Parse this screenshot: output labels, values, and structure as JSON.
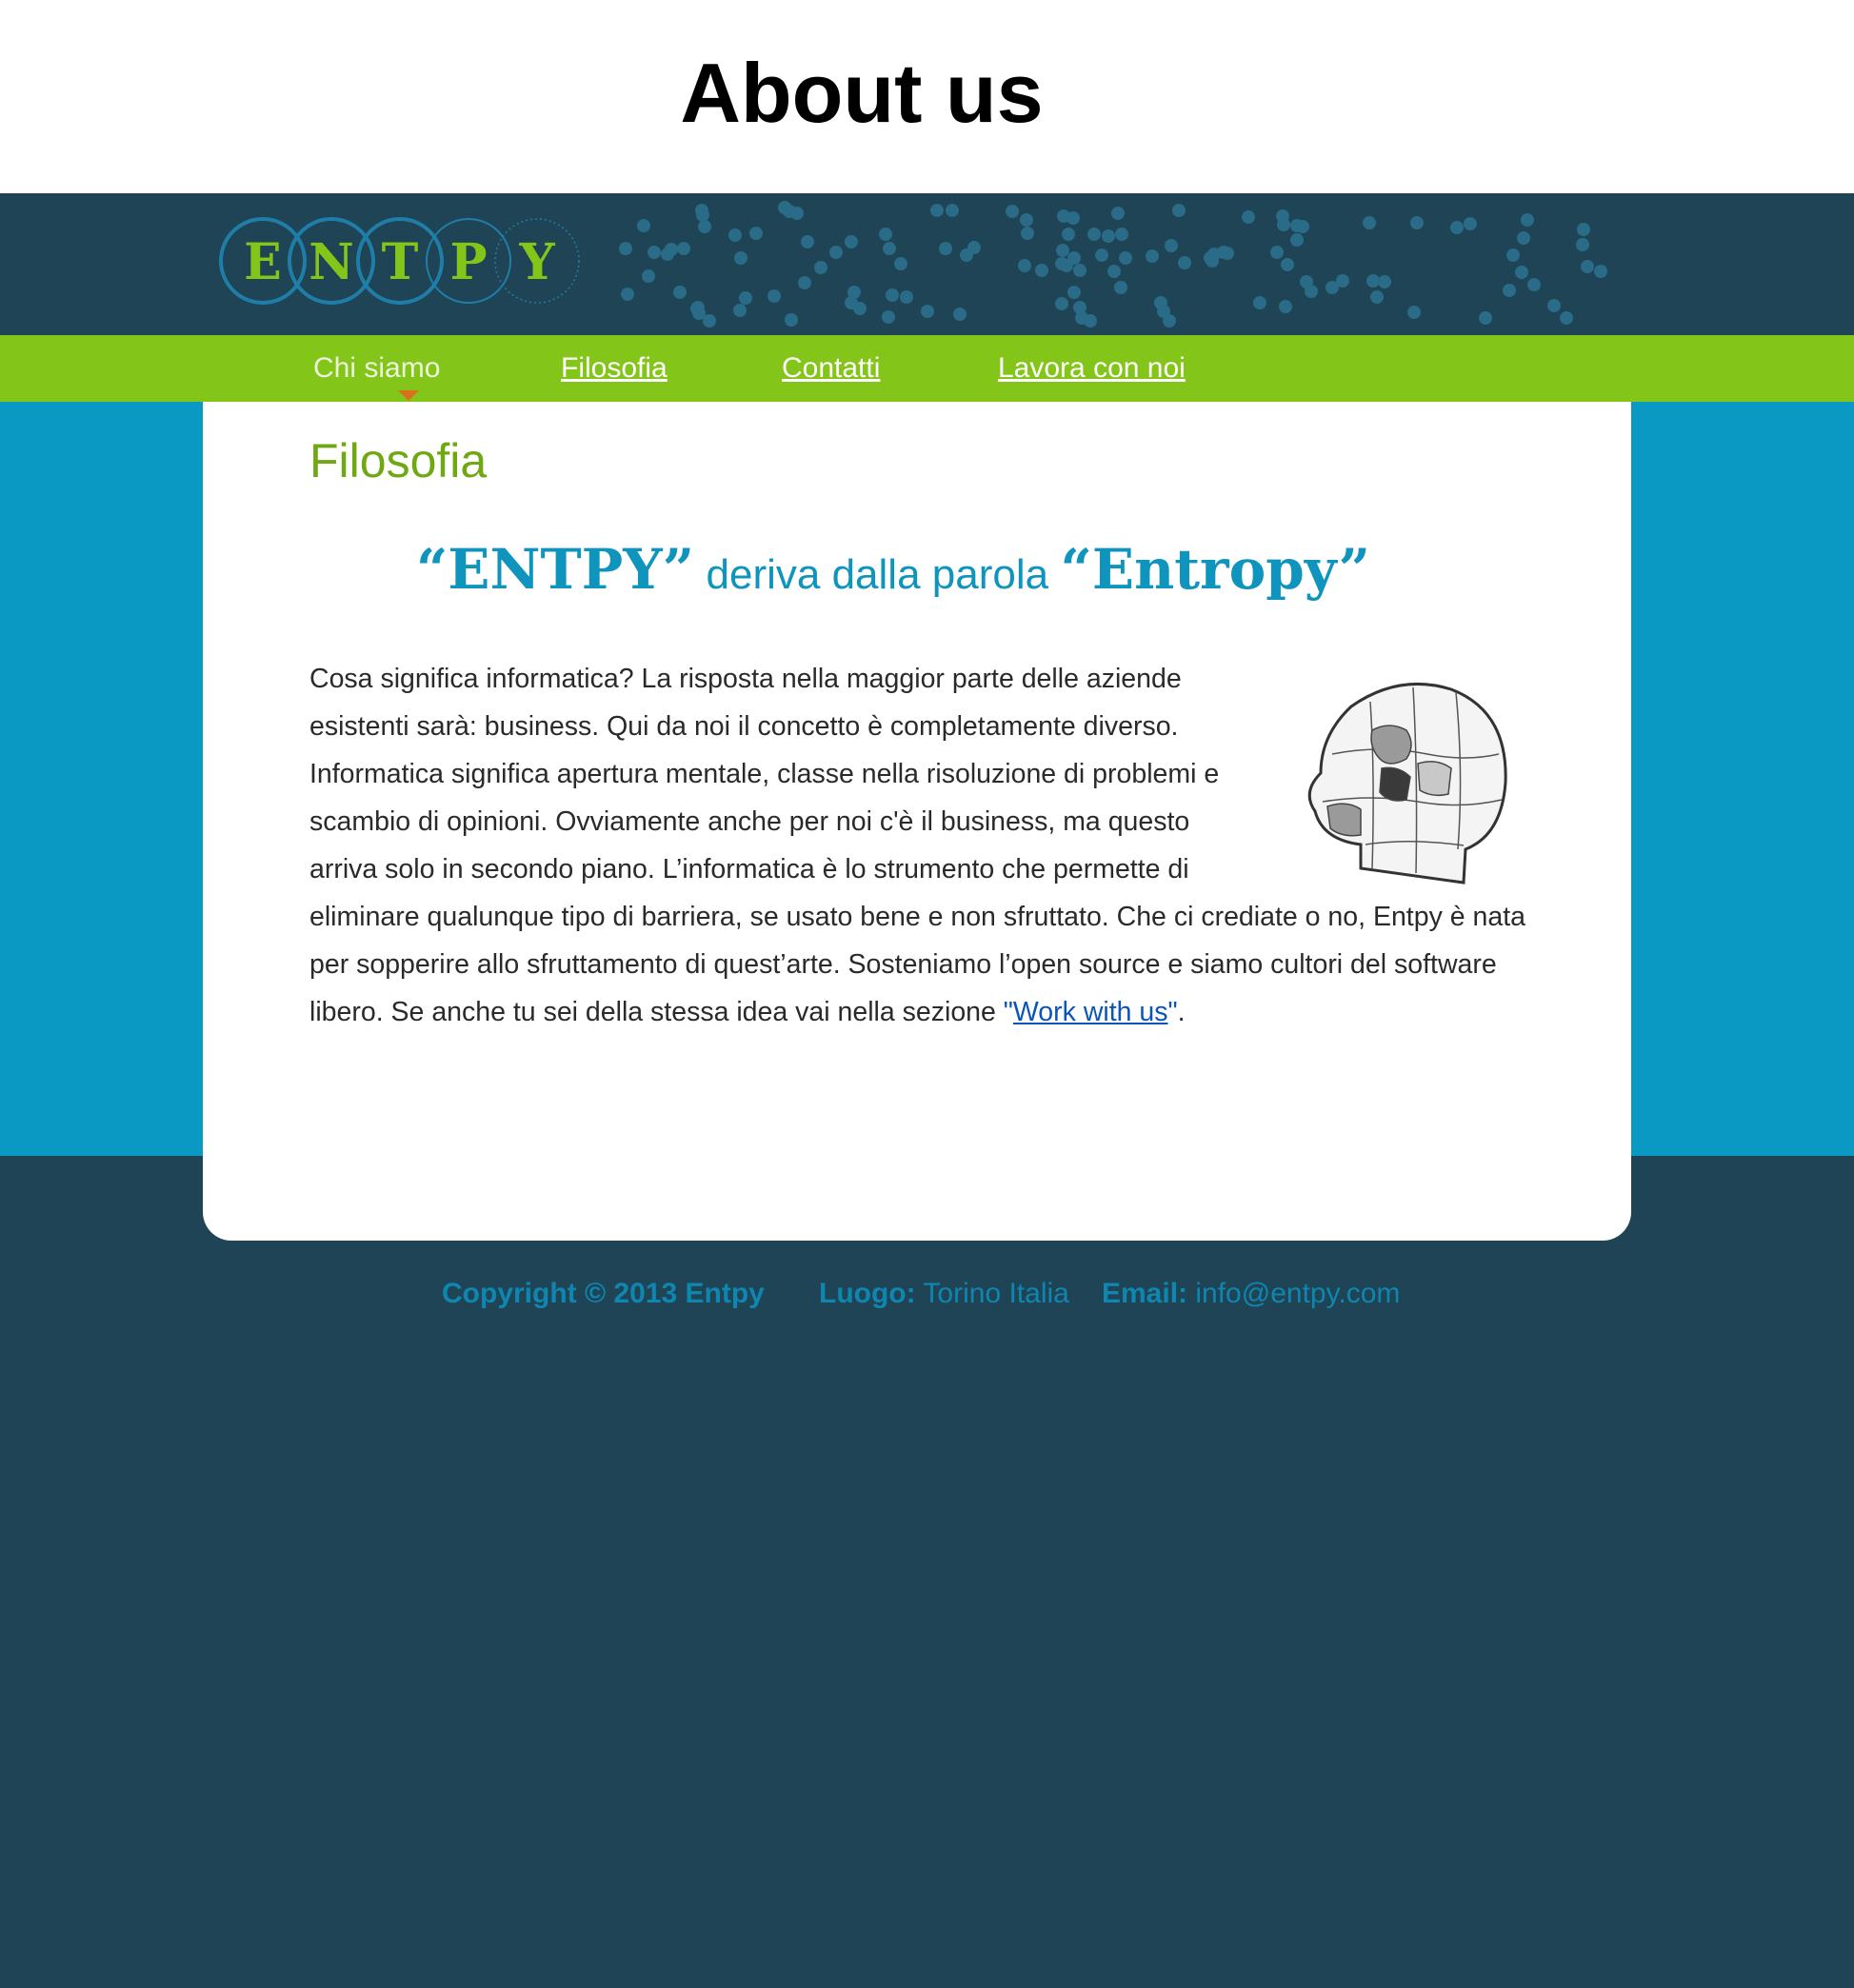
{
  "page": {
    "heading": "About us"
  },
  "logo": {
    "letters": [
      "E",
      "N",
      "T",
      "P",
      "Y"
    ],
    "text_color": "#84c51a",
    "ring_color": "#1f7ea8"
  },
  "nav": {
    "items": [
      {
        "label": "Chi siamo",
        "active": true
      },
      {
        "label": "Filosofia",
        "active": false
      },
      {
        "label": "Contatti",
        "active": false
      },
      {
        "label": "Lavora con noi",
        "active": false
      }
    ]
  },
  "content": {
    "section_title": "Filosofia",
    "tagline": {
      "brand_quoted": "“ENTPY”",
      "middle": "deriva dalla parola",
      "word_quoted": "“Entropy”"
    },
    "image_icon": "puzzle-head-icon",
    "body_text": "Cosa significa informatica? La risposta nella maggior parte delle aziende esistenti sarà: business. Qui da noi il concetto è completamente diverso. Informatica significa apertura mentale, classe nella risoluzione di problemi e scambio di opinioni. Ovviamente anche per noi c'è il business, ma questo arriva solo in secondo piano. L’informatica è lo strumento che permette di eliminare qualunque tipo di barriera, se usato bene e non sfruttato. Che ci crediate o no, Entpy è nata per sopperire allo sfruttamento di quest’arte. Sosteniamo l’open source e siamo cultori del software libero. Se anche tu sei della stessa idea vai nella sezione ",
    "link_open_quote": "\"",
    "link_label": "Work with us",
    "link_close_quote": "\"",
    "body_end": "."
  },
  "footer": {
    "copyright": "Copyright © 2013  Entpy",
    "location_label": "Luogo:",
    "location_value": "Torino Italia",
    "email_label": "Email:",
    "email_value": "info@entpy.com"
  },
  "colors": {
    "header_dark": "#1f4455",
    "nav_green": "#84c51a",
    "band_blue": "#0999c3",
    "title_green": "#6ea812",
    "tagline_blue": "#0f95bd",
    "link_blue": "#0a55b8",
    "footer_text": "#0f86b0"
  }
}
